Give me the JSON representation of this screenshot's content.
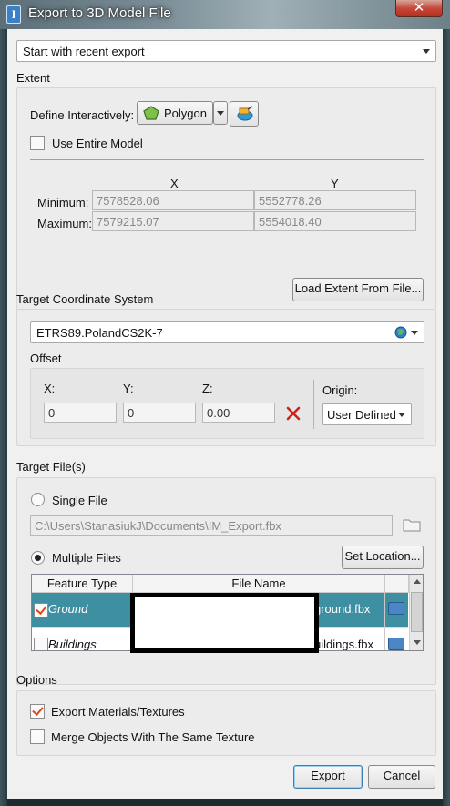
{
  "window": {
    "title": "Export to 3D Model File",
    "close_glyph": "✕"
  },
  "preset": {
    "value": "Start with recent export"
  },
  "extent": {
    "section_label": "Extent",
    "define_label": "Define Interactively:",
    "polygon_label": "Polygon",
    "use_entire_label": "Use Entire Model",
    "col_x": "X",
    "col_y": "Y",
    "min_label": "Minimum:",
    "max_label": "Maximum:",
    "min_x": "7578528.06",
    "min_y": "5552778.26",
    "max_x": "7579215.07",
    "max_y": "5554018.40",
    "load_button": "Load Extent From File..."
  },
  "crs": {
    "section_label": "Target Coordinate System",
    "value": "ETRS89.PolandCS2K-7",
    "offset_label": "Offset",
    "x_label": "X:",
    "y_label": "Y:",
    "z_label": "Z:",
    "x_value": "0",
    "y_value": "0",
    "z_value": "0.00",
    "origin_label": "Origin:",
    "origin_value": "User Defined"
  },
  "target": {
    "section_label": "Target File(s)",
    "single_label": "Single File",
    "single_path": "C:\\Users\\StanasiukJ\\Documents\\IM_Export.fbx",
    "multiple_label": "Multiple Files",
    "set_location_button": "Set Location...",
    "columns": [
      "Feature Type",
      "File Name"
    ],
    "rows": [
      {
        "feature": "Ground",
        "file": "ground.fbx",
        "checked": true
      },
      {
        "feature": "Buildings",
        "file": "uildings.fbx",
        "checked": false
      }
    ]
  },
  "options": {
    "section_label": "Options",
    "materials_label": "Export Materials/Textures",
    "merge_label": "Merge Objects With The Same Texture"
  },
  "footer": {
    "export_button": "Export",
    "cancel_button": "Cancel"
  },
  "colors": {
    "selected_row": "#3f8fa3",
    "close_red": "#c7473a",
    "delete_red": "#d0201c"
  }
}
